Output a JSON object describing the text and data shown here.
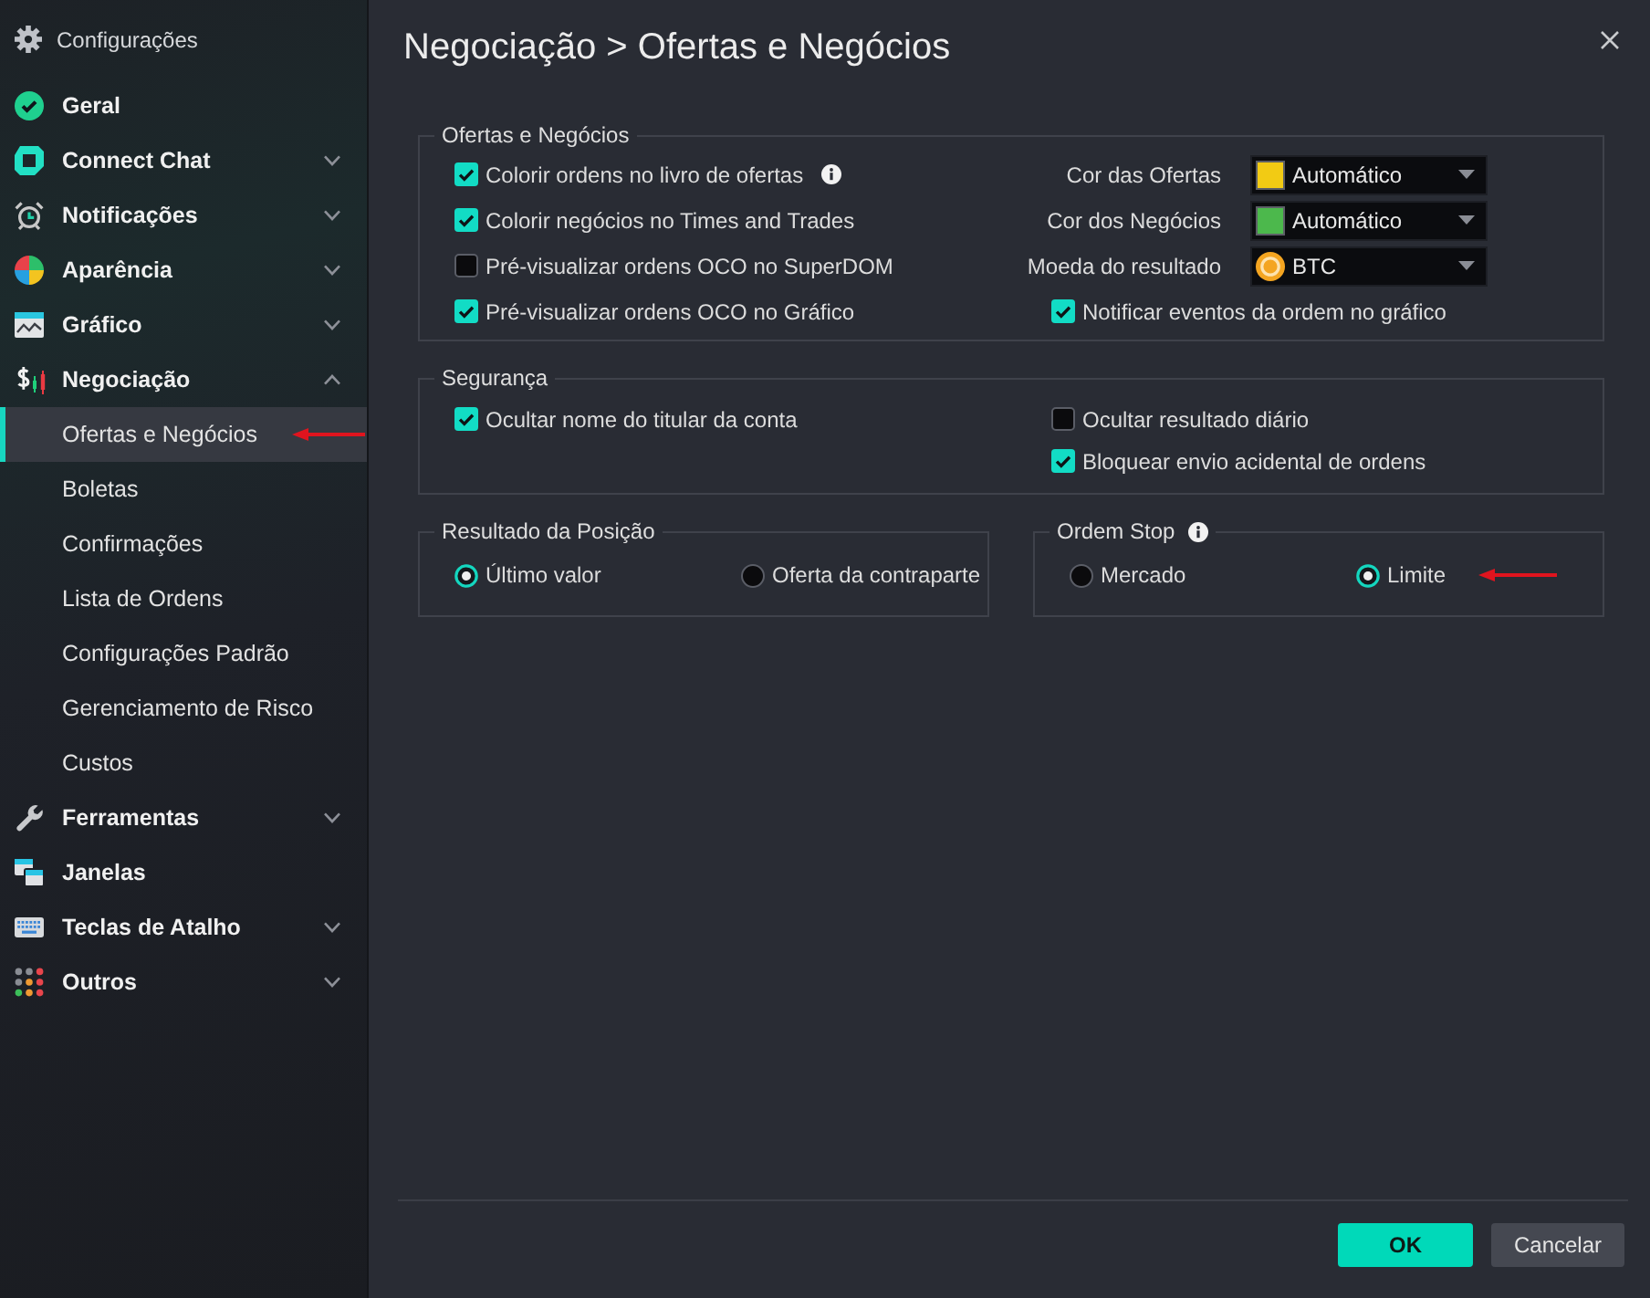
{
  "sidebar": {
    "title": "Configurações",
    "items": [
      {
        "label": "Geral",
        "kind": "page"
      },
      {
        "label": "Connect Chat",
        "kind": "group",
        "expanded": false
      },
      {
        "label": "Notificações",
        "kind": "group",
        "expanded": false
      },
      {
        "label": "Aparência",
        "kind": "group",
        "expanded": false
      },
      {
        "label": "Gráfico",
        "kind": "group",
        "expanded": false
      },
      {
        "label": "Negociação",
        "kind": "group",
        "expanded": true,
        "children": [
          {
            "label": "Ofertas e Negócios",
            "selected": true,
            "arrow": true
          },
          {
            "label": "Boletas",
            "selected": false
          },
          {
            "label": "Confirmações",
            "selected": false
          },
          {
            "label": "Lista de Ordens",
            "selected": false
          },
          {
            "label": "Configurações Padrão",
            "selected": false
          },
          {
            "label": "Gerenciamento de Risco",
            "selected": false
          },
          {
            "label": "Custos",
            "selected": false
          }
        ]
      },
      {
        "label": "Ferramentas",
        "kind": "group",
        "expanded": false
      },
      {
        "label": "Janelas",
        "kind": "page"
      },
      {
        "label": "Teclas de Atalho",
        "kind": "group",
        "expanded": false
      },
      {
        "label": "Outros",
        "kind": "group",
        "expanded": false
      }
    ]
  },
  "page": {
    "title": "Negociação > Ofertas e Negócios"
  },
  "groups": [
    {
      "legend": "Ofertas e Negócios",
      "left": [
        {
          "kind": "checkbox",
          "label": "Colorir ordens no livro de ofertas",
          "checked": true,
          "info": true
        },
        {
          "kind": "checkbox",
          "label": "Colorir negócios no Times and Trades",
          "checked": true
        },
        {
          "kind": "checkbox",
          "label": "Pré-visualizar ordens OCO no SuperDOM",
          "checked": false
        },
        {
          "kind": "checkbox",
          "label": "Pré-visualizar ordens OCO no Gráfico",
          "checked": true
        }
      ],
      "right": [
        {
          "kind": "color_select",
          "label": "Cor das Ofertas",
          "value": "Automático",
          "color": "#f2cb14"
        },
        {
          "kind": "color_select",
          "label": "Cor dos Negócios",
          "value": "Automático",
          "color": "#4cb84c"
        },
        {
          "kind": "currency_select",
          "label": "Moeda do resultado",
          "value": "BTC"
        },
        {
          "kind": "checkbox",
          "label": "Notificar eventos da ordem no gráfico",
          "checked": true
        }
      ]
    },
    {
      "legend": "Segurança",
      "left": [
        {
          "kind": "checkbox",
          "label": "Ocultar nome do titular da conta",
          "checked": true
        }
      ],
      "right": [
        {
          "kind": "checkbox",
          "label": "Ocultar resultado diário",
          "checked": false
        },
        {
          "kind": "checkbox",
          "label": "Bloquear envio acidental de ordens",
          "checked": true
        }
      ]
    }
  ],
  "radio_groups": [
    {
      "legend": "Resultado da Posição",
      "options": [
        {
          "label": "Último valor",
          "selected": true
        },
        {
          "label": "Oferta da contraparte",
          "selected": false
        }
      ]
    },
    {
      "legend": "Ordem Stop",
      "info": true,
      "options": [
        {
          "label": "Mercado",
          "selected": false
        },
        {
          "label": "Limite",
          "selected": true,
          "arrow": true
        }
      ]
    }
  ],
  "buttons": [
    {
      "label": "OK",
      "kind": "primary"
    },
    {
      "label": "Cancelar",
      "kind": "secondary"
    }
  ]
}
